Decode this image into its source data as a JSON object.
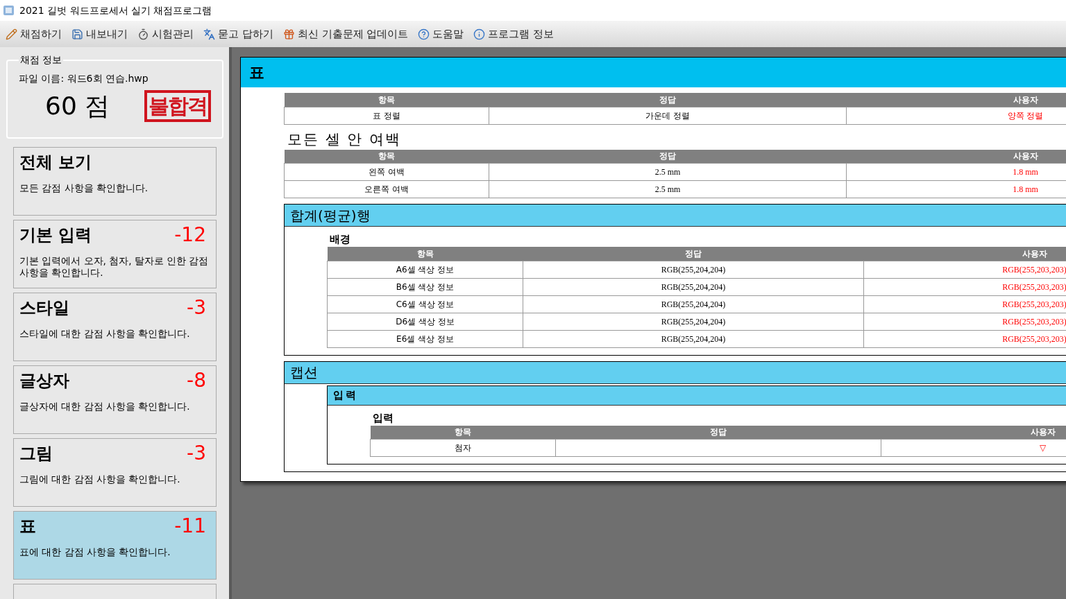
{
  "window": {
    "title": "2021 길벗 워드프로세서 실기 채점프로그램"
  },
  "toolbar": [
    {
      "label": "채점하기"
    },
    {
      "label": "내보내기"
    },
    {
      "label": "시험관리"
    },
    {
      "label": "묻고 답하기"
    },
    {
      "label": "최신 기출문제 업데이트"
    },
    {
      "label": "도움말"
    },
    {
      "label": "프로그램 정보"
    }
  ],
  "score_panel": {
    "legend": "채점 정보",
    "file_name": "파일 이름: 워드6회 연습.hwp",
    "score": "60 점",
    "result_stamp": "불합격"
  },
  "categories": [
    {
      "title": "전체 보기",
      "description": "모든 감점 사항을 확인합니다.",
      "selected": false
    },
    {
      "title": "기본 입력",
      "deduction": "-12",
      "description": "기본 입력에서 오자, 첨자, 탈자로 인한 감점 사항을 확인합니다.",
      "selected": false
    },
    {
      "title": "스타일",
      "deduction": "-3",
      "description": "스타일에 대한 감점 사항을 확인합니다.",
      "selected": false
    },
    {
      "title": "글상자",
      "deduction": "-8",
      "description": "글상자에 대한 감점 사항을 확인합니다.",
      "selected": false
    },
    {
      "title": "그림",
      "deduction": "-3",
      "description": "그림에 대한 감점 사항을 확인합니다.",
      "selected": false
    },
    {
      "title": "표",
      "deduction": "-11",
      "description": "표에 대한 감점 사항을 확인합니다.",
      "selected": true
    }
  ],
  "report": {
    "title": "표",
    "blocks": [
      {
        "kind": "table",
        "columns": [
          "항목",
          "정답",
          "사용자"
        ],
        "rows": [
          {
            "item": "표 정렬",
            "answer": "가운데 정렬",
            "user": "양쪽 정렬"
          }
        ]
      },
      {
        "kind": "heading",
        "text": "모든 셀 안 여백"
      },
      {
        "kind": "table",
        "columns": [
          "항목",
          "정답",
          "사용자"
        ],
        "rows": [
          {
            "item": "왼쪽 여백",
            "answer": "2.5 mm",
            "user": "1.8 mm"
          },
          {
            "item": "오른쪽 여백",
            "answer": "2.5 mm",
            "user": "1.8 mm"
          }
        ]
      },
      {
        "kind": "section",
        "title": "합계(평균)행",
        "children": [
          {
            "kind": "subheading",
            "text": "배경"
          },
          {
            "kind": "table",
            "columns": [
              "항목",
              "정답",
              "사용자"
            ],
            "rows": [
              {
                "item": "A6셀 색상 정보",
                "answer": "RGB(255,204,204)",
                "user": "RGB(255,203,203)"
              },
              {
                "item": "B6셀 색상 정보",
                "answer": "RGB(255,204,204)",
                "user": "RGB(255,203,203)"
              },
              {
                "item": "C6셀 색상 정보",
                "answer": "RGB(255,204,204)",
                "user": "RGB(255,203,203)"
              },
              {
                "item": "D6셀 색상 정보",
                "answer": "RGB(255,204,204)",
                "user": "RGB(255,203,203)"
              },
              {
                "item": "E6셀 색상 정보",
                "answer": "RGB(255,204,204)",
                "user": "RGB(255,203,203)"
              }
            ]
          }
        ]
      },
      {
        "kind": "section",
        "title": "캡션",
        "children": [
          {
            "kind": "section",
            "title": "입력",
            "children": [
              {
                "kind": "subheading",
                "text": "입력"
              },
              {
                "kind": "table",
                "columns": [
                  "항목",
                  "정답",
                  "사용자"
                ],
                "rows": [
                  {
                    "item": "첨자",
                    "user": "▽"
                  }
                ]
              }
            ]
          }
        ]
      }
    ]
  }
}
